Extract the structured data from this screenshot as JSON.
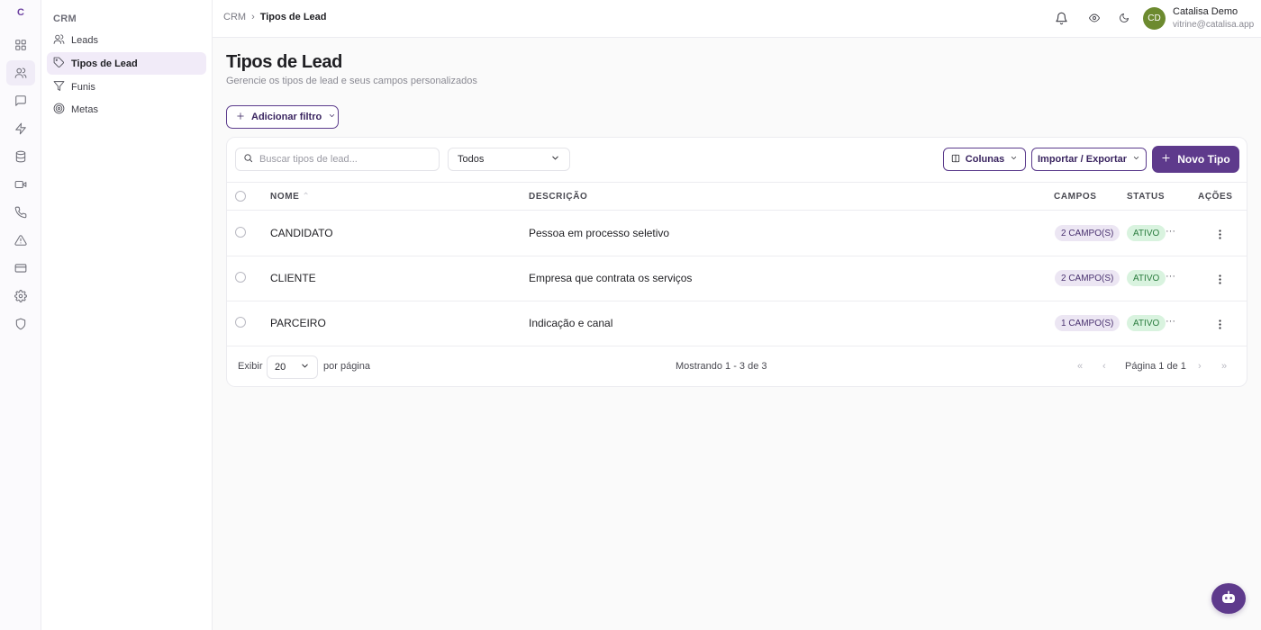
{
  "app": {
    "logo_letter": "C"
  },
  "rail": {
    "icons": [
      "dashboard-icon",
      "users-icon",
      "chat-icon",
      "zap-icon",
      "database-icon",
      "video-icon",
      "phone-icon",
      "alert-icon",
      "card-icon",
      "settings-icon",
      "shield-icon"
    ],
    "active": "users-icon"
  },
  "subnav": {
    "section_title": "CRM",
    "items": [
      {
        "label": "Leads",
        "icon": "users-icon"
      },
      {
        "label": "Tipos de Lead",
        "icon": "tag-icon",
        "active": true
      },
      {
        "label": "Funis",
        "icon": "filter-icon"
      },
      {
        "label": "Metas",
        "icon": "target-icon"
      }
    ]
  },
  "header": {
    "breadcrumb": {
      "root": "CRM",
      "separator": "›",
      "current": "Tipos de Lead"
    },
    "user": {
      "initials": "CD",
      "name": "Catalisa Demo",
      "email": "vitrine@catalisa.app"
    }
  },
  "page": {
    "title": "Tipos de Lead",
    "subtitle": "Gerencie os tipos de lead e seus campos personalizados",
    "filter_button": "Adicionar filtro"
  },
  "toolbar": {
    "search_placeholder": "Buscar tipos de lead...",
    "status_select": "Todos",
    "columns_button": "Colunas",
    "import_export_button": "Importar / Exportar",
    "new_button": "Novo Tipo"
  },
  "table": {
    "columns": {
      "name": "NOME",
      "sort_indicator": "⌃",
      "description": "DESCRIÇÃO",
      "fields": "CAMPOS",
      "status": "STATUS",
      "actions": "AÇÕES"
    },
    "rows": [
      {
        "name": "CANDIDATO",
        "description": "Pessoa em processo seletivo",
        "fields": "2 CAMPO(S)",
        "status": "ATIVO",
        "ellipsis": "···"
      },
      {
        "name": "CLIENTE",
        "description": "Empresa que contrata os serviços",
        "fields": "2 CAMPO(S)",
        "status": "ATIVO",
        "ellipsis": "···"
      },
      {
        "name": "PARCEIRO",
        "description": "Indicação e canal",
        "fields": "1 CAMPO(S)",
        "status": "ATIVO",
        "ellipsis": "···"
      }
    ]
  },
  "pagination": {
    "show_label": "Exibir",
    "page_size": "20",
    "per_page_label": "por página",
    "summary": "Mostrando 1 - 3 de 3",
    "first": "«",
    "prev": "‹",
    "page_info": "Página 1 de 1",
    "next": "›",
    "last": "»"
  },
  "colors": {
    "accent": "#5e3a8c",
    "active_bg": "#f1ebf8",
    "status_bg": "#d9f3df",
    "status_text": "#2b7d3f",
    "avatar_bg": "#6c8a2f"
  }
}
